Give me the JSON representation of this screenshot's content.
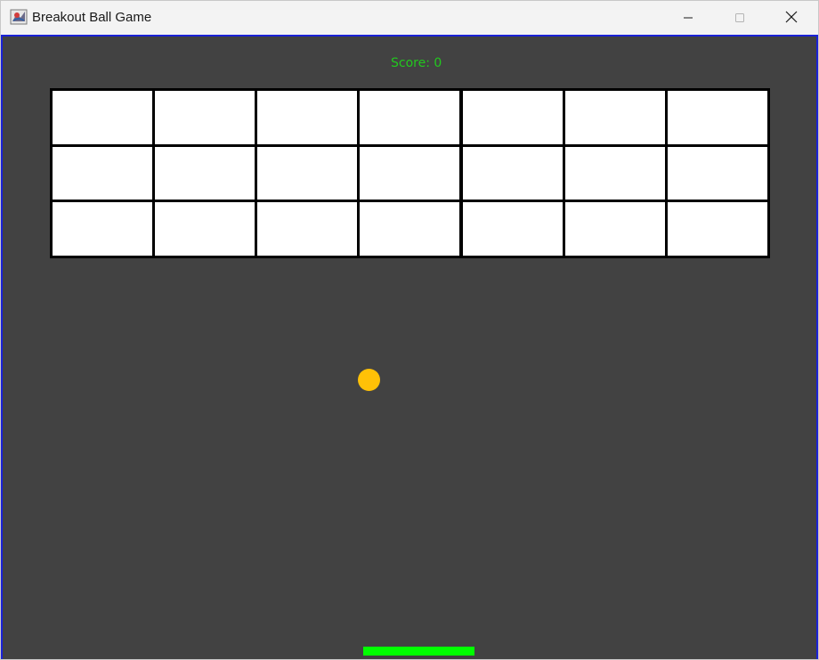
{
  "window": {
    "title": "Breakout Ball Game",
    "icon": "java-app-icon",
    "controls": {
      "minimize_icon": "minimize-icon",
      "maximize_icon": "maximize-icon",
      "close_icon": "close-icon"
    }
  },
  "game": {
    "score_label": "Score: 0",
    "score": 0,
    "bricks": {
      "rows": 3,
      "columns": 7,
      "color": "#ffffff",
      "border_color": "#000000"
    },
    "colors": {
      "background": "#424242",
      "border": "#1a22d6",
      "score_text": "#22c81e",
      "ball": "#ffc107",
      "paddle": "#00ff00"
    }
  }
}
